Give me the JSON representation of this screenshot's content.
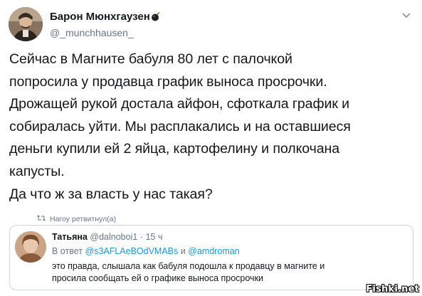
{
  "tweet": {
    "display_name": "Барон Мюнхгаузен",
    "name_emoji": "bomb-icon",
    "handle": "@_munchhausen_",
    "text_lines": [
      "Сейчас в Магните бабуля 80 лет с палочкой",
      "попросила у продавца график выноса просрочки.",
      "Дрожащей рукой достала айфон, сфоткала график и",
      "собиралась уйти. Мы расплакались и на оставшиеся",
      "деньги купили ей 2 яйца, картофелину и полкочана",
      "капусты.",
      "Да что ж за власть у нас такая?"
    ]
  },
  "retweet": {
    "label": "Hагоу ретвитнул(а)"
  },
  "reply": {
    "name": "Татьяна",
    "handle": "@dalnoboi1",
    "separator": "·",
    "time": "15 ч",
    "reply_to_prefix": "В ответ",
    "mention_1": "@s3AFLAeBOdVMABs",
    "conjunction": "и",
    "mention_2": "@amdroman",
    "body_lines": [
      "это правда,  слышала как бабуля подошла к продавцу в магните и",
      "просила сообщать ей о графике выноса просрочки"
    ]
  },
  "watermark": "Fishki.net",
  "colors": {
    "text": "#14171a",
    "secondary": "#657786",
    "link": "#1b95e0",
    "border": "#ccd6dd"
  }
}
